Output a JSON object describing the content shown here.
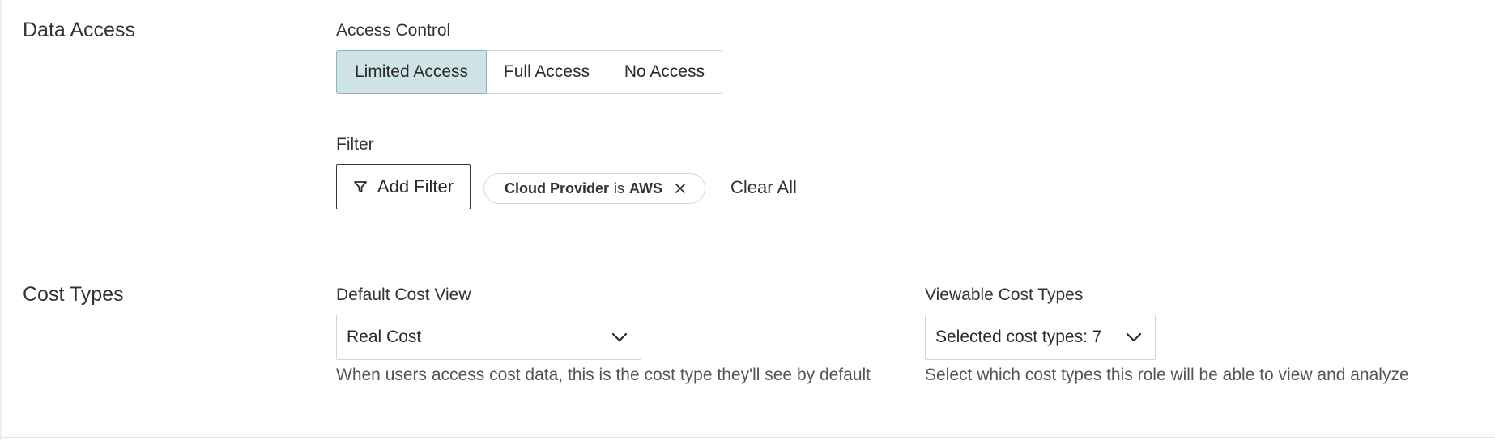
{
  "data_access": {
    "section_title": "Data Access",
    "access_control": {
      "label": "Access Control",
      "options": [
        "Limited Access",
        "Full Access",
        "No Access"
      ],
      "selected": "Limited Access"
    },
    "filter": {
      "label": "Filter",
      "add_button": "Add Filter",
      "chips": [
        {
          "field": "Cloud Provider",
          "operator": "is",
          "value": "AWS"
        }
      ],
      "clear_all": "Clear All"
    }
  },
  "cost_types": {
    "section_title": "Cost Types",
    "default_cost_view": {
      "label": "Default Cost View",
      "value": "Real Cost",
      "help": "When users access cost data, this is the cost type they'll see by default"
    },
    "viewable_cost_types": {
      "label": "Viewable Cost Types",
      "value": "Selected cost types: 7",
      "help": "Select which cost types this role will be able to view and analyze"
    }
  },
  "colors": {
    "selected_segment_bg": "#cfe2e5",
    "selected_segment_border": "#8db3b9",
    "divider": "#e6e4de"
  }
}
